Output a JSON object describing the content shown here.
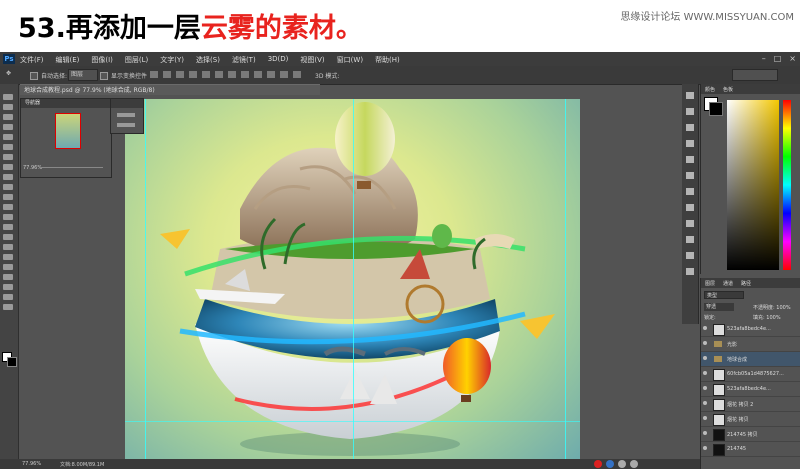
{
  "header": {
    "title_main": "53.再添加一层",
    "title_highlight": "云雾的素材。",
    "site_credit": "思缘设计论坛 WWW.MISSYUAN.COM"
  },
  "colors": {
    "highlight": "#e8231e",
    "ps_bg": "#535353",
    "panel_dark": "#3c3c3c"
  },
  "menubar": {
    "logo": "Ps",
    "items": [
      "文件(F)",
      "编辑(E)",
      "图像(I)",
      "图层(L)",
      "文字(Y)",
      "选择(S)",
      "滤镜(T)",
      "3D(D)",
      "视图(V)",
      "窗口(W)",
      "帮助(H)"
    ]
  },
  "options": {
    "auto_select_label": "自动选择:",
    "auto_select_value": "图层",
    "show_transform_label": "显示变换控件",
    "mode_3d": "3D 模式:"
  },
  "document_tab": "地球合成教程.psd @ 77.9% (地球合成, RGB/8)",
  "navigator": {
    "tab": "导航器",
    "zoom": "77.96%"
  },
  "color_panel": {
    "tabs": [
      "颜色",
      "色板"
    ]
  },
  "layers": {
    "tabs": [
      "图层",
      "通道",
      "路径"
    ],
    "filter": "类型",
    "blend": "穿透",
    "opacity_label": "不透明度:",
    "opacity": "100%",
    "lock_label": "锁定:",
    "fill_label": "填充:",
    "fill": "100%",
    "items": [
      {
        "name": "523afa8bedc4e...",
        "kind": "layer"
      },
      {
        "name": "光影",
        "kind": "group"
      },
      {
        "name": "地球合成",
        "kind": "group"
      },
      {
        "name": "60fcb05a1d4875627...",
        "kind": "layer"
      },
      {
        "name": "523afa8bedc4e...",
        "kind": "layer"
      },
      {
        "name": "烟花 拷贝 2",
        "kind": "layer"
      },
      {
        "name": "烟花 拷贝",
        "kind": "layer"
      },
      {
        "name": "214745 拷贝",
        "kind": "dark"
      },
      {
        "name": "214745",
        "kind": "dark"
      }
    ]
  },
  "status": {
    "zoom": "77.96%",
    "doc": "文档:8.00M/89.1M"
  }
}
